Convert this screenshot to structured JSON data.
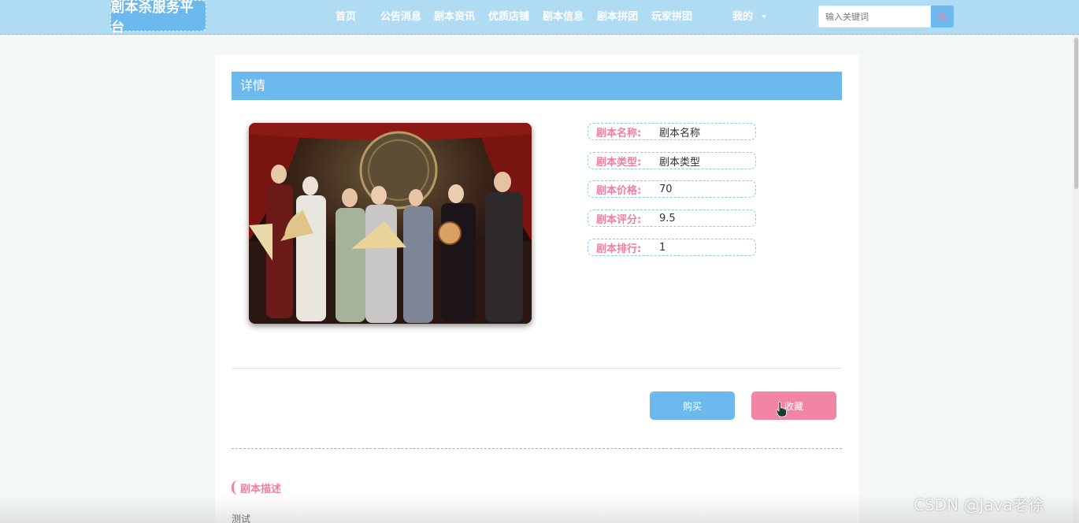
{
  "header": {
    "logo_text": "剧本杀服务平台",
    "nav": [
      {
        "label": "首页"
      },
      {
        "label": "公告消息"
      },
      {
        "label": "剧本资讯"
      },
      {
        "label": "优质店铺"
      },
      {
        "label": "剧本信息"
      },
      {
        "label": "剧本拼团"
      },
      {
        "label": "玩家拼团"
      },
      {
        "label": "我的"
      }
    ],
    "search_placeholder": "输入关键词",
    "search_icon": "search-icon"
  },
  "detail": {
    "section_title": "详情",
    "image_alt": "剧本图片",
    "fields": [
      {
        "label": "剧本名称:",
        "value": "剧本名称"
      },
      {
        "label": "剧本类型:",
        "value": "剧本类型"
      },
      {
        "label": "剧本价格:",
        "value": "70"
      },
      {
        "label": "剧本评分:",
        "value": "9.5"
      },
      {
        "label": "剧本排行:",
        "value": "1"
      }
    ],
    "buy_label": "购买",
    "favorite_label": "收藏",
    "description_title": "剧本描述",
    "description_text": "测试"
  },
  "watermark": "CSDN @Java老徐",
  "colors": {
    "header_bg": "#b0dcf3",
    "accent_blue": "#6cb9ee",
    "accent_pink": "#f284a4",
    "label_pink": "#ee7f9e"
  }
}
